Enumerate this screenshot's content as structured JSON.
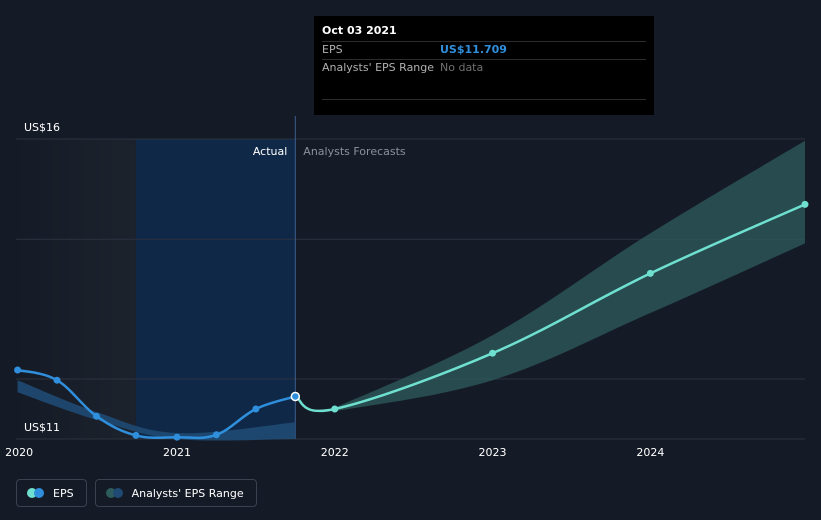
{
  "tooltip": {
    "date": "Oct 03 2021",
    "rows": [
      {
        "label": "EPS",
        "value": "US$11.709"
      },
      {
        "label": "Analysts' EPS Range",
        "value": "No data"
      }
    ]
  },
  "legend": [
    {
      "label": "EPS"
    },
    {
      "label": "Analysts' EPS Range"
    }
  ],
  "colors": {
    "eps_actual": "#2f8fdc",
    "eps_forecast": "#6fe0d0",
    "range_band": "#2e5c5c",
    "actual_highlight": "#0e2a4d",
    "gridline": "#2b3340",
    "background": "#151b26"
  },
  "chart_data": {
    "type": "line",
    "x_tick_labels": [
      "2020",
      "2021",
      "2022",
      "2023",
      "2024"
    ],
    "y_tick_labels": [
      "US$16",
      "US$11"
    ],
    "ylim": [
      11,
      16
    ],
    "xlim": [
      2019.98,
      2024.98
    ],
    "region_labels": {
      "actual": "Actual",
      "forecast": "Analysts Forecasts"
    },
    "series": [
      {
        "name": "EPS",
        "points": [
          {
            "x": 2019.99,
            "y": 12.15
          },
          {
            "x": 2020.24,
            "y": 11.98
          },
          {
            "x": 2020.49,
            "y": 11.38
          },
          {
            "x": 2020.74,
            "y": 11.06
          },
          {
            "x": 2021.0,
            "y": 11.03
          },
          {
            "x": 2021.25,
            "y": 11.07
          },
          {
            "x": 2021.5,
            "y": 11.5
          },
          {
            "x": 2021.75,
            "y": 11.709
          }
        ]
      },
      {
        "name": "EPS Forecast",
        "points": [
          {
            "x": 2021.75,
            "y": 11.709
          },
          {
            "x": 2022.0,
            "y": 11.5
          },
          {
            "x": 2023.0,
            "y": 12.43
          },
          {
            "x": 2024.0,
            "y": 13.76
          },
          {
            "x": 2024.98,
            "y": 14.91
          }
        ]
      },
      {
        "name": "Analysts' EPS Range",
        "lower": [
          {
            "x": 2022.0,
            "y": 11.46
          },
          {
            "x": 2023.0,
            "y": 11.98
          },
          {
            "x": 2024.0,
            "y": 13.1
          },
          {
            "x": 2024.98,
            "y": 14.26
          }
        ],
        "upper": [
          {
            "x": 2022.0,
            "y": 11.52
          },
          {
            "x": 2023.0,
            "y": 12.73
          },
          {
            "x": 2024.0,
            "y": 14.43
          },
          {
            "x": 2024.98,
            "y": 15.97
          }
        ]
      },
      {
        "name": "Actual EPS Range",
        "lower": [
          {
            "x": 2019.99,
            "y": 11.78
          },
          {
            "x": 2020.49,
            "y": 11.32
          },
          {
            "x": 2021.0,
            "y": 11.0
          },
          {
            "x": 2021.75,
            "y": 11.0
          }
        ],
        "upper": [
          {
            "x": 2019.99,
            "y": 11.98
          },
          {
            "x": 2020.49,
            "y": 11.45
          },
          {
            "x": 2021.0,
            "y": 11.1
          },
          {
            "x": 2021.75,
            "y": 11.28
          }
        ]
      }
    ]
  }
}
